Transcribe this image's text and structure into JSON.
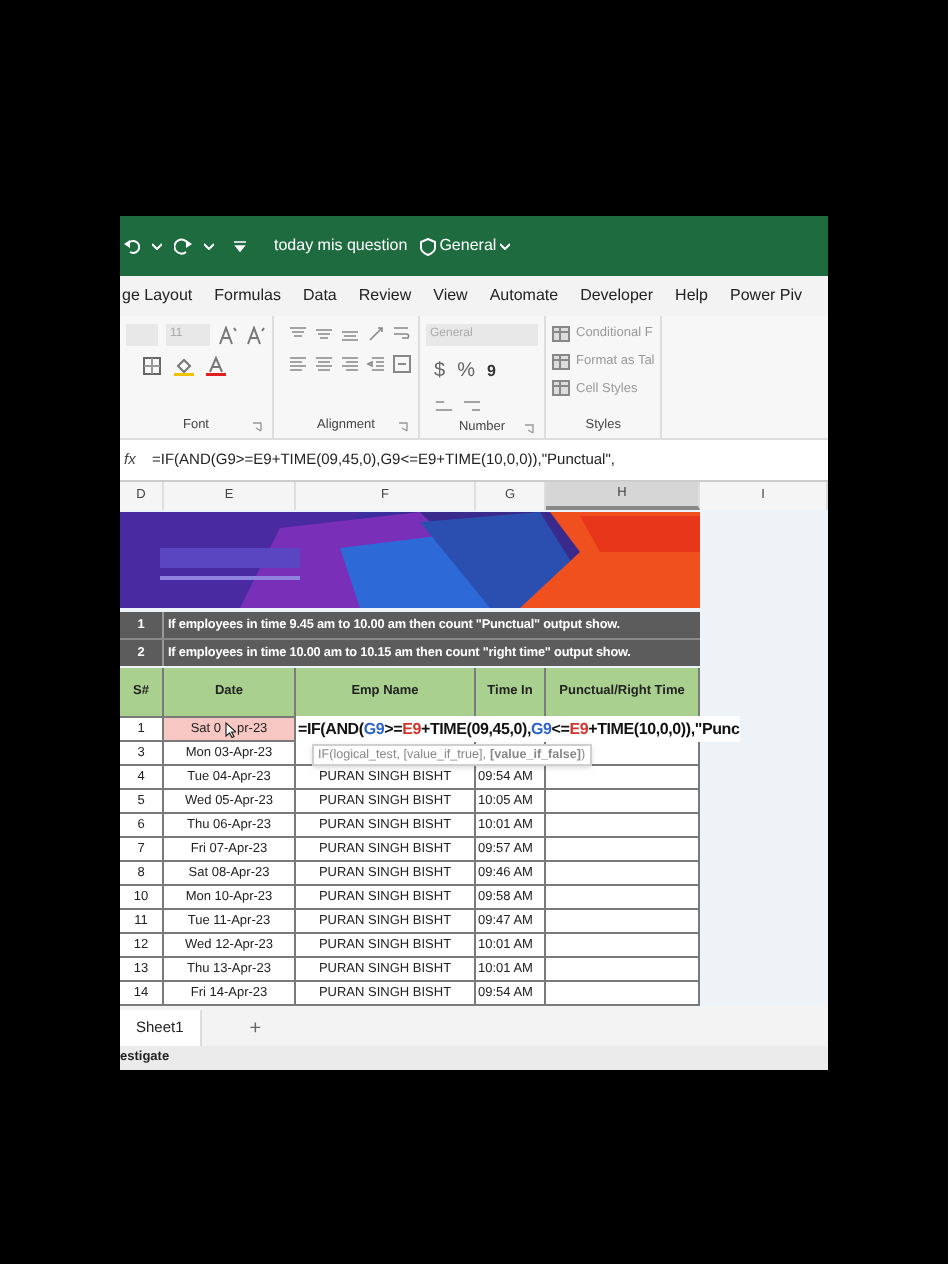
{
  "title_bar": {
    "document_title": "today mis question",
    "sensitivity_label": "General"
  },
  "menu_tabs": [
    "ge Layout",
    "Formulas",
    "Data",
    "Review",
    "View",
    "Automate",
    "Developer",
    "Help",
    "Power Piv"
  ],
  "ribbon": {
    "font_size": "11",
    "number_format": "General",
    "currency_symbol": "$",
    "percent_symbol": "%",
    "comma_symbol": "9",
    "styles_items": [
      "Conditional F",
      "Format as Tal",
      "Cell Styles"
    ],
    "group_labels": [
      "Font",
      "Alignment",
      "Number",
      "Styles"
    ]
  },
  "formula_bar": {
    "fx": "fx",
    "formula": "=IF(AND(G9>=E9+TIME(09,45,0),G9<=E9+TIME(10,0,0)),\"Punctual\","
  },
  "column_headers": [
    {
      "label": "D",
      "selected": false
    },
    {
      "label": "E",
      "selected": false
    },
    {
      "label": "F",
      "selected": false
    },
    {
      "label": "G",
      "selected": false
    },
    {
      "label": "H",
      "selected": true
    },
    {
      "label": "I",
      "selected": false
    }
  ],
  "notes": [
    {
      "number": "1",
      "text": "If employees in time 9.45 am to 10.00 am then count \"Punctual\" output show."
    },
    {
      "number": "2",
      "text": "If employees in time 10.00 am to 10.15 am then count \"right time\" output show."
    }
  ],
  "table": {
    "columns": [
      "S#",
      "Date",
      "Emp Name",
      "Time In",
      "Punctual/Right Time"
    ],
    "rows": [
      {
        "kind": "editing",
        "sn": "1",
        "date_before_cursor": "Sat 0",
        "date_after_cursor": "pr-23"
      },
      {
        "kind": "date_only",
        "sn": "3",
        "date": "Mon 03-Apr-23"
      },
      {
        "kind": "full",
        "sn": "4",
        "date": "Tue 04-Apr-23",
        "name": "PURAN SINGH BISHT",
        "time_in": "09:54 AM"
      },
      {
        "kind": "full",
        "sn": "5",
        "date": "Wed 05-Apr-23",
        "name": "PURAN SINGH BISHT",
        "time_in": "10:05 AM"
      },
      {
        "kind": "full",
        "sn": "6",
        "date": "Thu 06-Apr-23",
        "name": "PURAN SINGH BISHT",
        "time_in": "10:01 AM"
      },
      {
        "kind": "full",
        "sn": "7",
        "date": "Fri 07-Apr-23",
        "name": "PURAN SINGH BISHT",
        "time_in": "09:57 AM"
      },
      {
        "kind": "full",
        "sn": "8",
        "date": "Sat 08-Apr-23",
        "name": "PURAN SINGH BISHT",
        "time_in": "09:46 AM"
      },
      {
        "kind": "full",
        "sn": "10",
        "date": "Mon 10-Apr-23",
        "name": "PURAN SINGH BISHT",
        "time_in": "09:58 AM"
      },
      {
        "kind": "full",
        "sn": "11",
        "date": "Tue 11-Apr-23",
        "name": "PURAN SINGH BISHT",
        "time_in": "09:47 AM"
      },
      {
        "kind": "full",
        "sn": "12",
        "date": "Wed 12-Apr-23",
        "name": "PURAN SINGH BISHT",
        "time_in": "10:01 AM"
      },
      {
        "kind": "full",
        "sn": "13",
        "date": "Thu 13-Apr-23",
        "name": "PURAN SINGH BISHT",
        "time_in": "10:01 AM"
      },
      {
        "kind": "full",
        "sn": "14",
        "date": "Fri 14-Apr-23",
        "name": "PURAN SINGH BISHT",
        "time_in": "09:54 AM"
      }
    ]
  },
  "in_cell_formula": [
    {
      "text": "=IF(AND(",
      "color": "#111111"
    },
    {
      "text": "G9",
      "color": "#2f64c8"
    },
    {
      "text": ">=",
      "color": "#111111"
    },
    {
      "text": "E9",
      "color": "#d0342c"
    },
    {
      "text": "+TIME(09,45,0),",
      "color": "#111111"
    },
    {
      "text": "G9",
      "color": "#2f64c8"
    },
    {
      "text": "<=",
      "color": "#111111"
    },
    {
      "text": "E9",
      "color": "#d0342c"
    },
    {
      "text": "+TIME(10,0,0)),\"Punc",
      "color": "#111111"
    }
  ],
  "tooltip": "IF(logical_test, [value_if_true], **[value_if_false]**)",
  "sheet_tabs": [
    {
      "label": "Sheet1",
      "selected": true
    }
  ],
  "add_sheet": "+",
  "status_bar": "estigate"
}
